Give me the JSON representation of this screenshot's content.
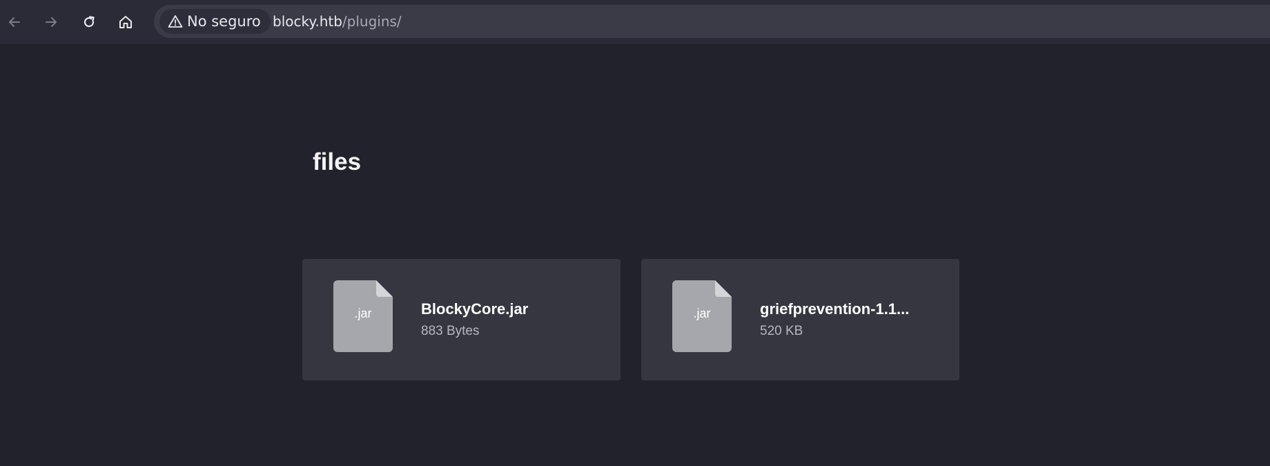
{
  "browser": {
    "nav": {
      "back_icon": "arrow-left-icon",
      "forward_icon": "arrow-right-icon",
      "reload_icon": "reload-icon",
      "home_icon": "home-icon"
    },
    "security": {
      "icon": "warning-triangle-icon",
      "label": "No seguro"
    },
    "url": {
      "host": "blocky.htb",
      "path": "/plugins/"
    }
  },
  "page": {
    "title": "files",
    "files": [
      {
        "icon_label": ".jar",
        "name": "BlockyCore.jar",
        "size": "883 Bytes"
      },
      {
        "icon_label": ".jar",
        "name": "griefprevention-1.1...",
        "size": "520 KB"
      }
    ]
  },
  "colors": {
    "background": "#22222c",
    "toolbar": "#2b2b37",
    "card": "#363641",
    "file_icon": "#a6a7ac"
  }
}
